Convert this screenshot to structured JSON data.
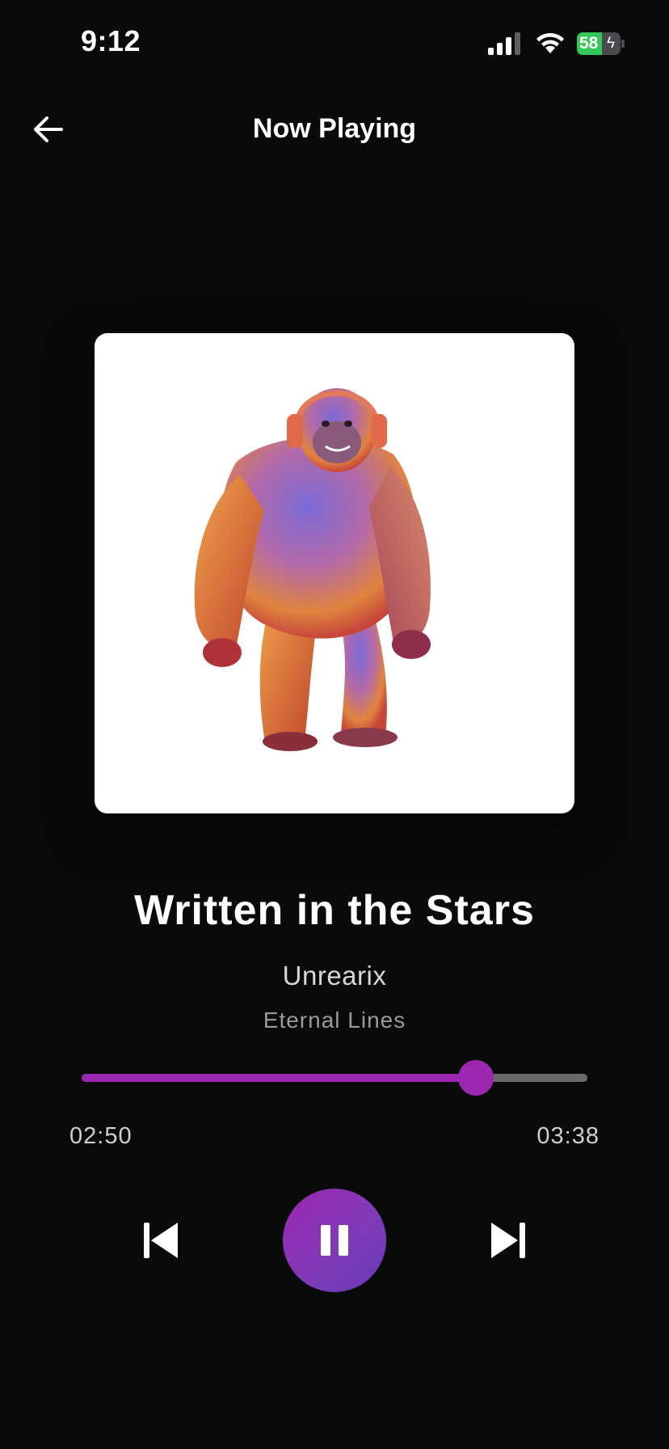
{
  "status_bar": {
    "time": "9:12",
    "battery_level": "58",
    "battery_fraction": 0.58,
    "battery_charging": true,
    "signal_icon": "cellular-signal-icon",
    "wifi_icon": "wifi-icon"
  },
  "header": {
    "title": "Now Playing",
    "back_icon": "arrow-left-icon"
  },
  "track": {
    "title": "Written in the Stars",
    "artist": "Unrearix",
    "album": "Eternal Lines",
    "artwork": "gorilla-with-headphones-illustration"
  },
  "playback": {
    "elapsed": "02:50",
    "total": "03:38",
    "progress_fraction": 0.78,
    "state": "playing"
  },
  "controls": {
    "previous_icon": "skip-previous-icon",
    "pause_icon": "pause-icon",
    "next_icon": "skip-next-icon"
  },
  "colors": {
    "background": "#0a0a0b",
    "accent": "#9c27b0",
    "accent_secondary": "#673ab7",
    "track_inactive": "#6b6b6b",
    "battery_green": "#34c759"
  }
}
